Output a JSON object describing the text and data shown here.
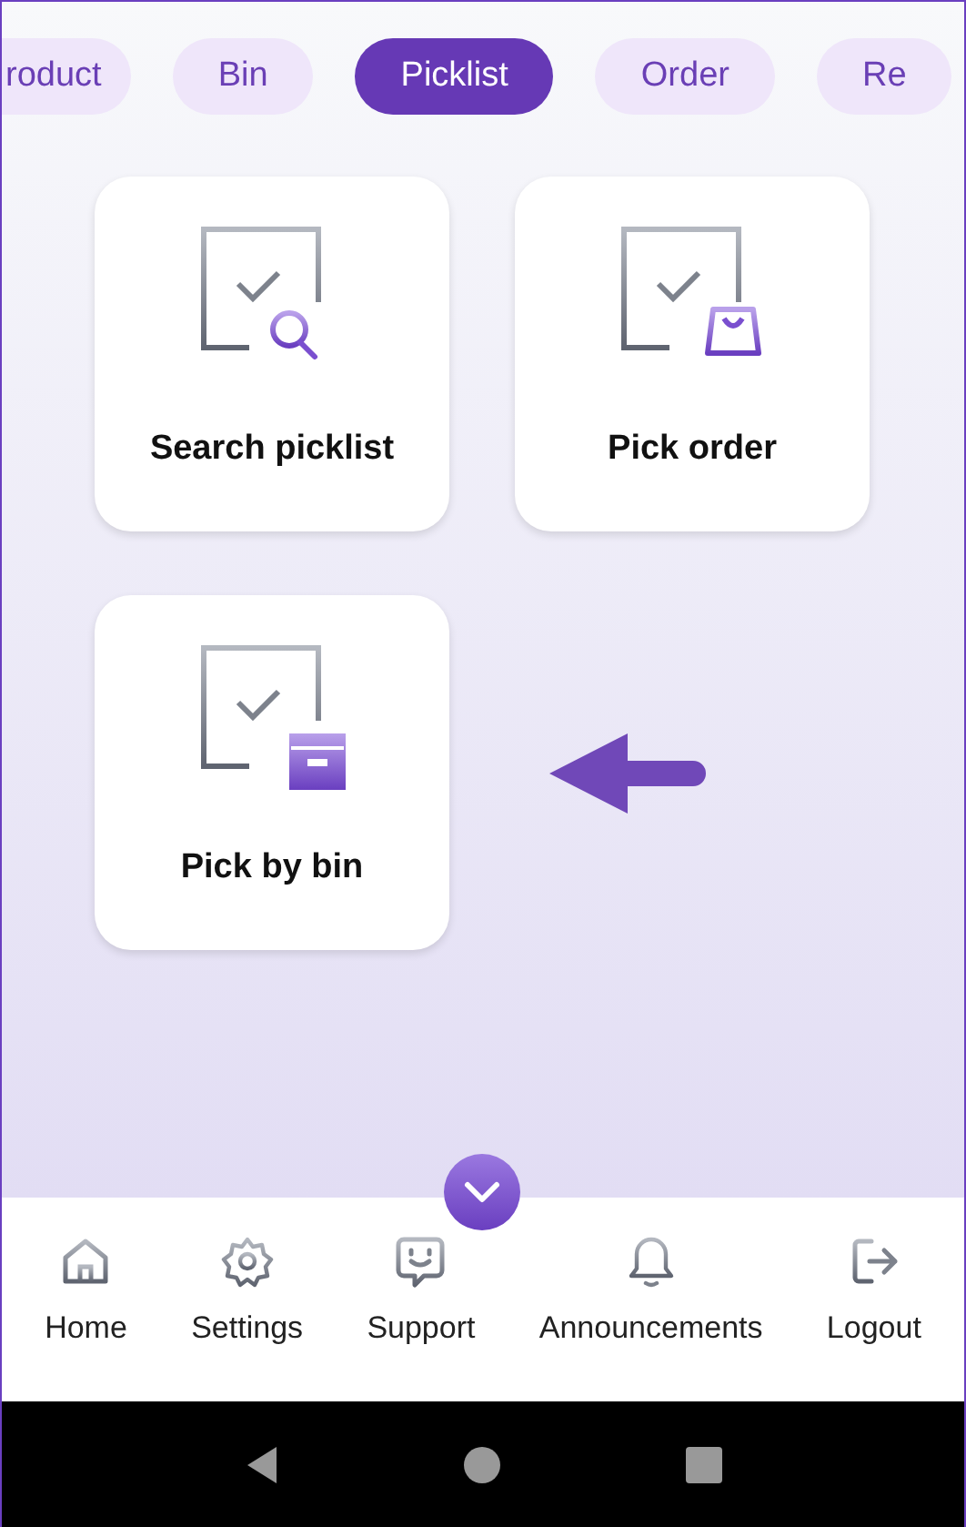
{
  "tabs": [
    {
      "label": "roduct",
      "selected": false
    },
    {
      "label": "Bin",
      "selected": false
    },
    {
      "label": "Picklist",
      "selected": true
    },
    {
      "label": "Order",
      "selected": false
    },
    {
      "label": "Re",
      "selected": false
    }
  ],
  "tiles": [
    {
      "label": "Search picklist",
      "kind": "search"
    },
    {
      "label": "Pick order",
      "kind": "bag"
    },
    {
      "label": "Pick by bin",
      "kind": "box"
    }
  ],
  "bottom_nav": [
    {
      "label": "Home",
      "kind": "home"
    },
    {
      "label": "Settings",
      "kind": "gear"
    },
    {
      "label": "Support",
      "kind": "chat"
    },
    {
      "label": "Announcements",
      "kind": "bell"
    },
    {
      "label": "Logout",
      "kind": "logout"
    }
  ]
}
